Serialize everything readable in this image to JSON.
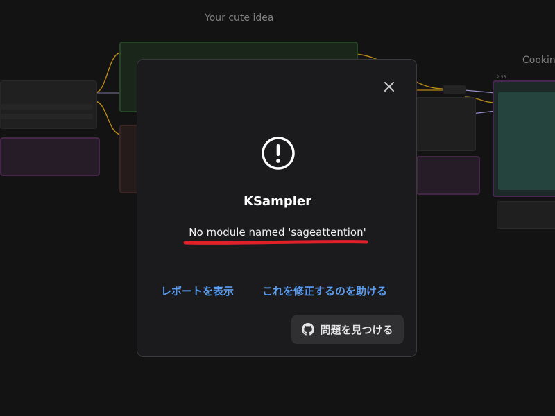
{
  "canvas": {
    "group_label_left": "Your cute idea",
    "group_label_right": "Cooking",
    "node_tag": "2.5B"
  },
  "dialog": {
    "title": "KSampler",
    "message": "No module named 'sageattention'",
    "report_link": "レポートを表示",
    "help_link": "これを修正するのを助ける",
    "find_issue_button": "問題を見つける",
    "accent_link_color": "#5a9cf0",
    "underline_color": "#e0212a"
  },
  "icons": {
    "close": "close-icon",
    "warning": "exclamation-circle-icon",
    "github": "github-icon"
  }
}
